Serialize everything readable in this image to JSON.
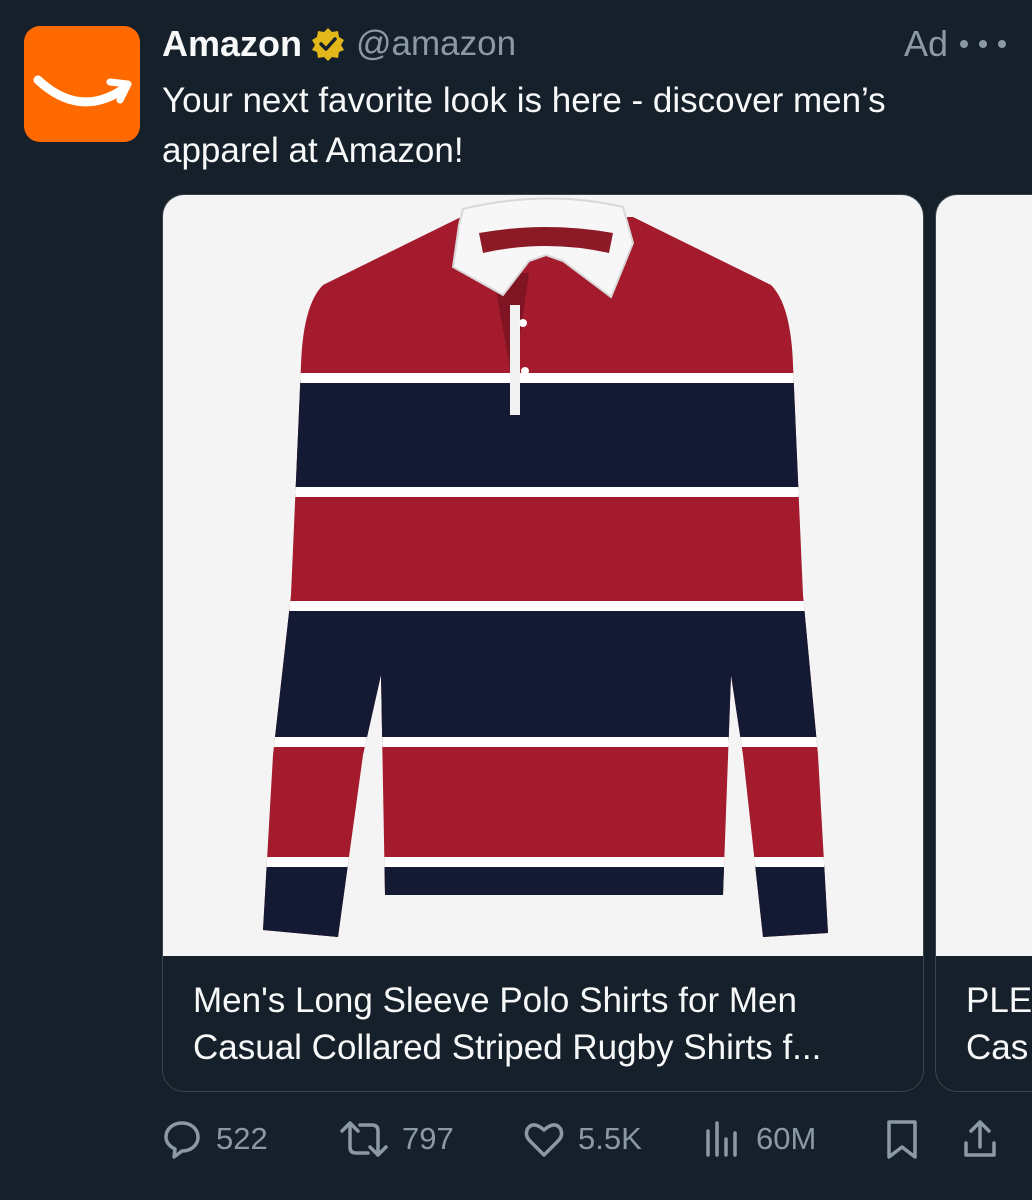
{
  "tweet": {
    "author_name": "Amazon",
    "handle": "@amazon",
    "ad_label": "Ad",
    "text": "Your next favorite look is here - discover men’s apparel at Amazon!"
  },
  "carousel": {
    "cards": [
      {
        "title": "Men's Long Sleeve Polo Shirts for Men Casual Collared Striped Rugby Shirts f..."
      },
      {
        "title": "PLE\nCas"
      }
    ]
  },
  "actions": {
    "replies": "522",
    "reposts": "797",
    "likes": "5.5K",
    "views": "60M"
  },
  "icons": {
    "avatar": "amazon-smile-logo",
    "verified": "verified-badge-icon",
    "more": "more-icon",
    "reply": "reply-icon",
    "repost": "repost-icon",
    "like": "heart-icon",
    "views": "views-icon",
    "bookmark": "bookmark-icon",
    "share": "share-icon"
  },
  "colors": {
    "background": "#15202b",
    "brand_orange": "#ff6a00",
    "verified_gold": "#e2b719",
    "muted_text": "#8b98a5"
  }
}
